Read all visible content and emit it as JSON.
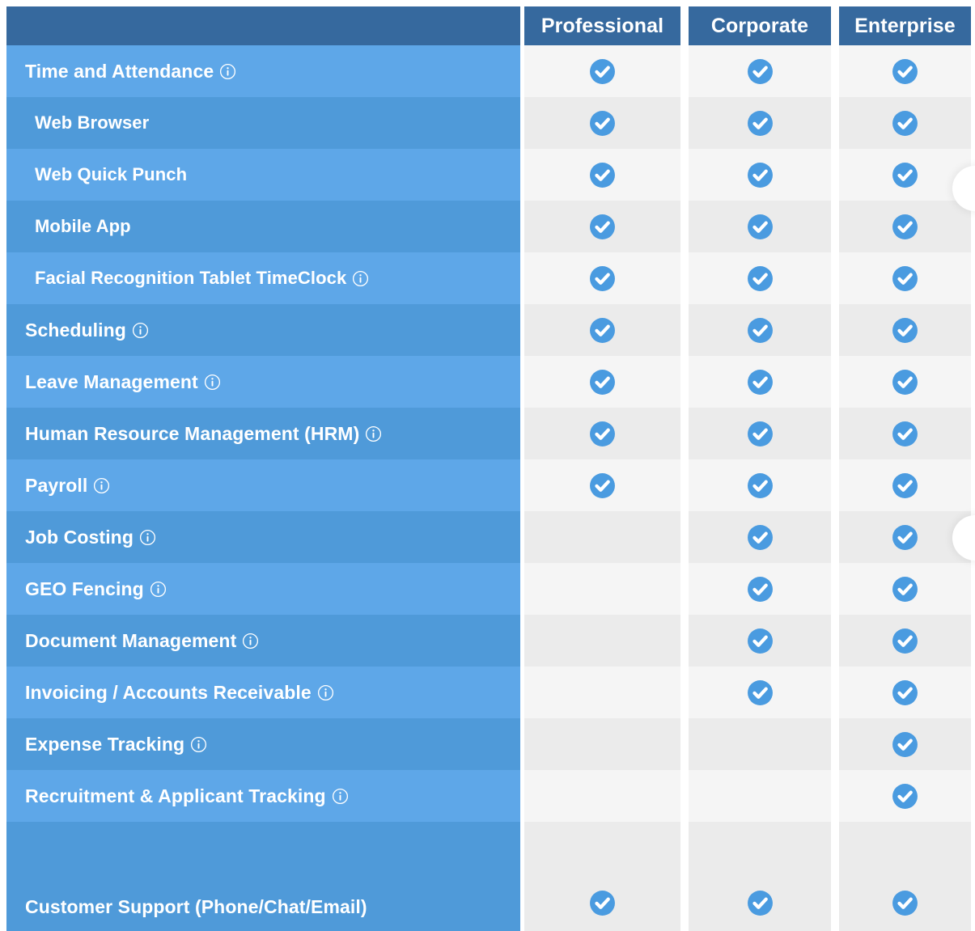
{
  "table": {
    "columns": [
      {
        "label": "",
        "key": "feature"
      },
      {
        "label": "Professional",
        "key": "professional"
      },
      {
        "label": "Corporate",
        "key": "corporate"
      },
      {
        "label": "Enterprise",
        "key": "enterprise"
      }
    ],
    "icons": {
      "check": "check-circle-icon",
      "info": "info-icon"
    },
    "colors": {
      "header_bg": "#36699E",
      "label_row_light": "#5EA7E8",
      "label_row_dark": "#4F9AD9",
      "data_row_light": "#F5F5F5",
      "data_row_dark": "#EBEBEB",
      "check_blue": "#4A9BE0",
      "text_white": "#FFFFFF"
    },
    "rows": [
      {
        "label": "Time and Attendance",
        "info": true,
        "sub": false,
        "professional": true,
        "corporate": true,
        "enterprise": true
      },
      {
        "label": "Web Browser",
        "info": false,
        "sub": true,
        "professional": true,
        "corporate": true,
        "enterprise": true
      },
      {
        "label": "Web Quick Punch",
        "info": false,
        "sub": true,
        "professional": true,
        "corporate": true,
        "enterprise": true
      },
      {
        "label": "Mobile App",
        "info": false,
        "sub": true,
        "professional": true,
        "corporate": true,
        "enterprise": true
      },
      {
        "label": "Facial Recognition Tablet TimeClock",
        "info": true,
        "sub": true,
        "professional": true,
        "corporate": true,
        "enterprise": true
      },
      {
        "label": "Scheduling",
        "info": true,
        "sub": false,
        "professional": true,
        "corporate": true,
        "enterprise": true
      },
      {
        "label": "Leave Management",
        "info": true,
        "sub": false,
        "professional": true,
        "corporate": true,
        "enterprise": true
      },
      {
        "label": "Human Resource Management (HRM)",
        "info": true,
        "sub": false,
        "professional": true,
        "corporate": true,
        "enterprise": true
      },
      {
        "label": "Payroll",
        "info": true,
        "sub": false,
        "professional": true,
        "corporate": true,
        "enterprise": true
      },
      {
        "label": "Job Costing",
        "info": true,
        "sub": false,
        "professional": false,
        "corporate": true,
        "enterprise": true
      },
      {
        "label": "GEO Fencing",
        "info": true,
        "sub": false,
        "professional": false,
        "corporate": true,
        "enterprise": true
      },
      {
        "label": "Document Management",
        "info": true,
        "sub": false,
        "professional": false,
        "corporate": true,
        "enterprise": true
      },
      {
        "label": "Invoicing / Accounts Receivable",
        "info": true,
        "sub": false,
        "professional": false,
        "corporate": true,
        "enterprise": true
      },
      {
        "label": "Expense Tracking",
        "info": true,
        "sub": false,
        "professional": false,
        "corporate": false,
        "enterprise": true
      },
      {
        "label": "Recruitment & Applicant Tracking",
        "info": true,
        "sub": false,
        "professional": false,
        "corporate": false,
        "enterprise": true
      },
      {
        "label": "Customer Support (Phone/Chat/Email)",
        "info": false,
        "sub": false,
        "professional": true,
        "corporate": true,
        "enterprise": true
      }
    ]
  }
}
